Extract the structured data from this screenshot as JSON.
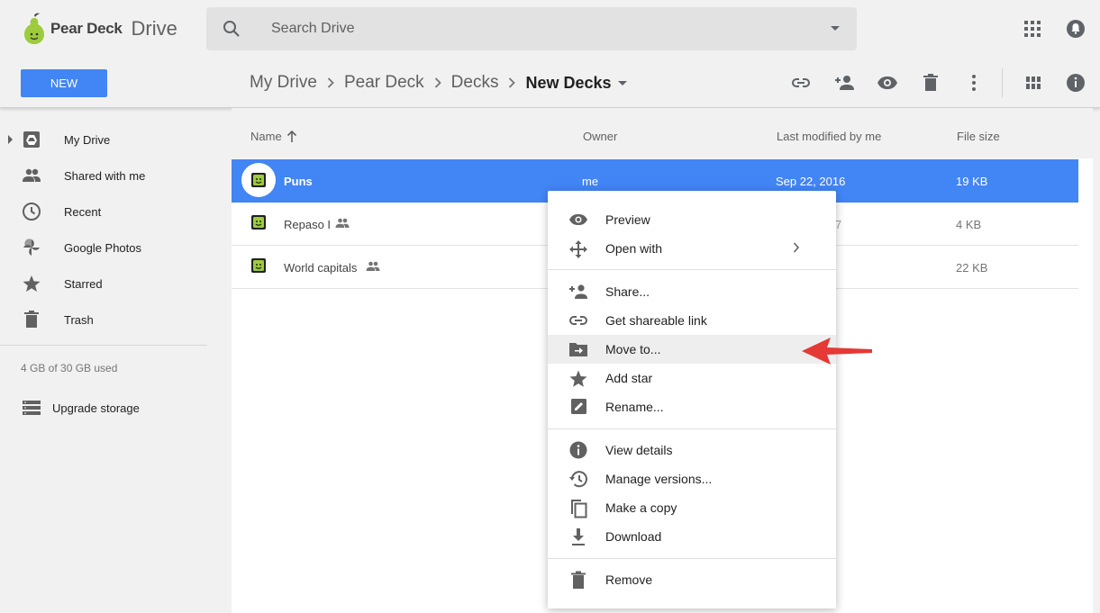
{
  "app": {
    "brand": "Pear Deck",
    "product": "Drive"
  },
  "search": {
    "placeholder": "Search Drive"
  },
  "toolbar": {
    "new_label": "NEW"
  },
  "breadcrumb": [
    "My Drive",
    "Pear Deck",
    "Decks",
    "New Decks"
  ],
  "sidebar": {
    "items": [
      {
        "label": "My Drive",
        "icon": "drive-icon"
      },
      {
        "label": "Shared with me",
        "icon": "people-icon"
      },
      {
        "label": "Recent",
        "icon": "clock-icon"
      },
      {
        "label": "Google Photos",
        "icon": "photos-icon"
      },
      {
        "label": "Starred",
        "icon": "star-icon"
      },
      {
        "label": "Trash",
        "icon": "trash-icon"
      }
    ],
    "storage": "4 GB of 30 GB used",
    "upgrade_label": "Upgrade storage"
  },
  "list": {
    "columns": {
      "name": "Name",
      "owner": "Owner",
      "modified": "Last modified by me",
      "size": "File size"
    },
    "rows": [
      {
        "name": "Puns",
        "owner": "me",
        "modified": "Sep 22, 2016",
        "size": "19 KB",
        "shared": false
      },
      {
        "name": "Repaso I",
        "owner": "",
        "modified": "7",
        "size": "4 KB",
        "shared": true
      },
      {
        "name": "World capitals",
        "owner": "",
        "modified": "",
        "size": "22 KB",
        "shared": true
      }
    ]
  },
  "context_menu": {
    "items": [
      {
        "label": "Preview",
        "icon": "eye-icon"
      },
      {
        "label": "Open with",
        "icon": "move-arrows-icon",
        "submenu": true
      },
      {
        "label": "Share...",
        "icon": "add-person-icon"
      },
      {
        "label": "Get shareable link",
        "icon": "link-icon"
      },
      {
        "label": "Move to...",
        "icon": "folder-move-icon",
        "highlighted": true
      },
      {
        "label": "Add star",
        "icon": "star-icon"
      },
      {
        "label": "Rename...",
        "icon": "edit-icon"
      },
      {
        "label": "View details",
        "icon": "info-icon"
      },
      {
        "label": "Manage versions...",
        "icon": "history-icon"
      },
      {
        "label": "Make a copy",
        "icon": "copy-icon"
      },
      {
        "label": "Download",
        "icon": "download-icon"
      },
      {
        "label": "Remove",
        "icon": "trash-icon"
      }
    ]
  },
  "colors": {
    "accent": "#4285f4",
    "selected_row": "#4285f4",
    "annotation_arrow": "#e53935",
    "pear_green": "#8bc34a"
  }
}
